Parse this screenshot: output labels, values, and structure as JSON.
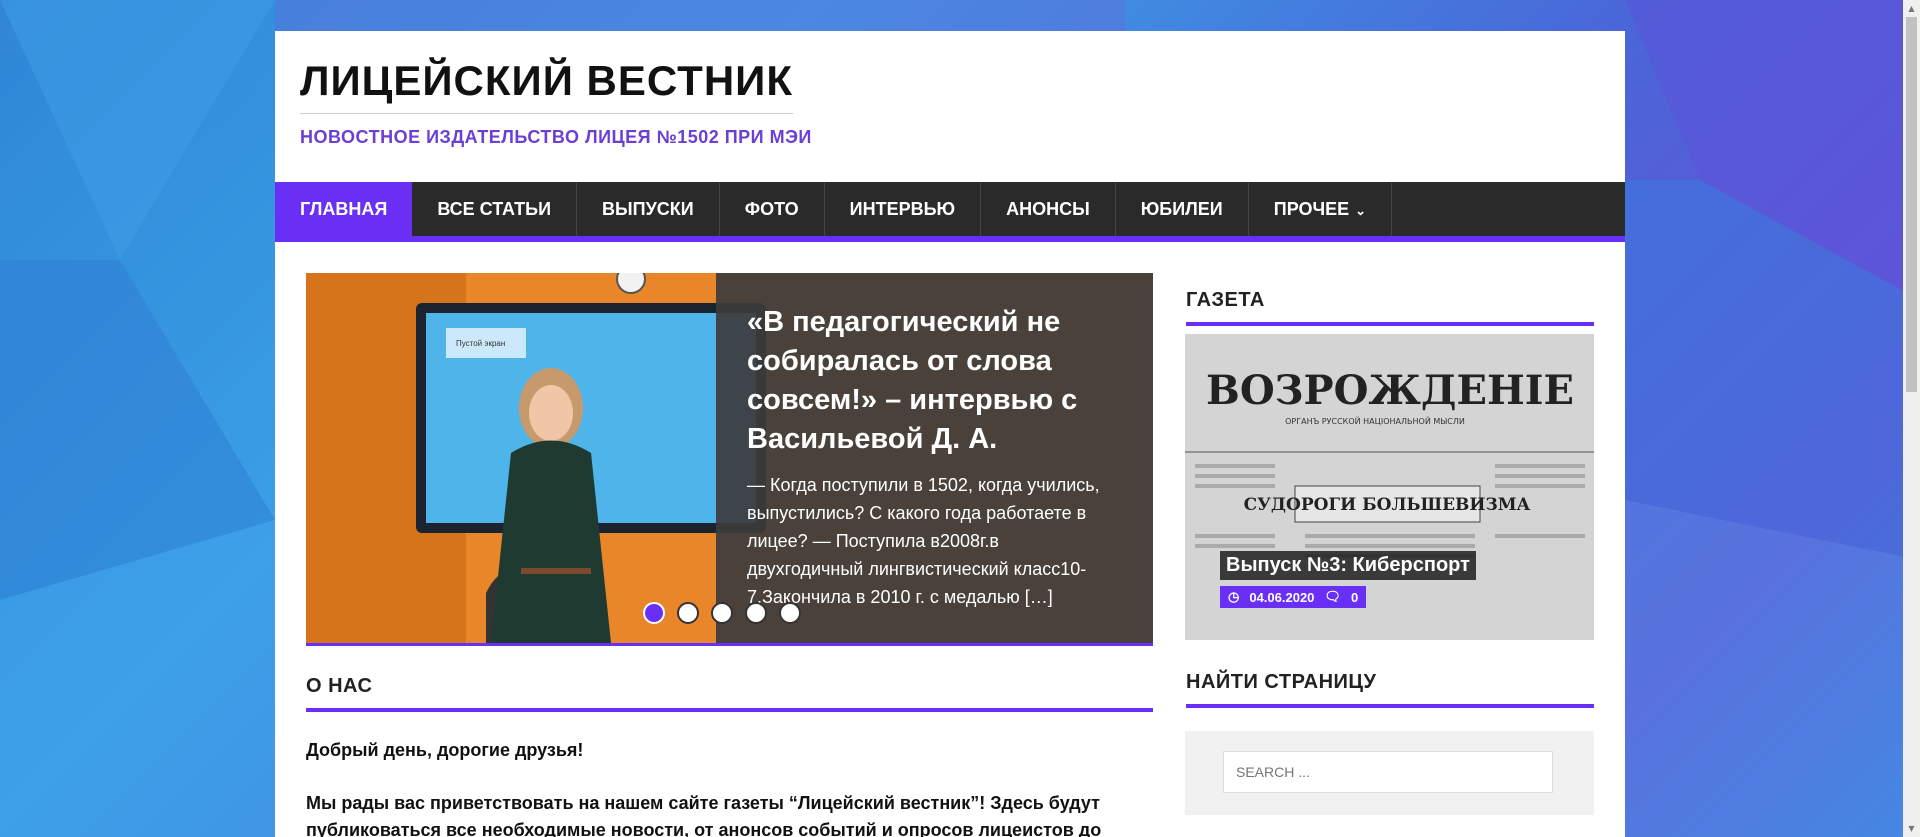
{
  "header": {
    "title": "ЛИЦЕЙСКИЙ ВЕСТНИК",
    "tagline": "НОВОСТНОЕ ИЗДАТЕЛЬСТВО ЛИЦЕЯ №1502 ПРИ МЭИ"
  },
  "nav": {
    "items": [
      {
        "label": "ГЛАВНАЯ"
      },
      {
        "label": "ВСЕ СТАТЬИ"
      },
      {
        "label": "ВЫПУСКИ"
      },
      {
        "label": "ФОТО"
      },
      {
        "label": "ИНТЕРВЬЮ"
      },
      {
        "label": "АНОНСЫ"
      },
      {
        "label": "ЮБИЛЕИ"
      },
      {
        "label": "ПРОЧЕЕ"
      }
    ]
  },
  "slider": {
    "title": "«В педагогический не собиралась от слова совсем!» – интервью с Васильевой Д. А.",
    "excerpt": "— Когда поступили в 1502, когда учились, выпустились? С какого года работаете в лицее? — Поступила в2008г.в двухгодичный лингвистический класс10-7.Закончила в 2010 г. с медалью […]",
    "screen_label": "Пустой экран"
  },
  "about": {
    "heading": "О НАС",
    "greeting": "Добрый день, дорогие друзья!",
    "text": "Мы рады вас приветствовать на нашем сайте газеты “Лицейский вестник”! Здесь будут публиковаться все необходимые новости, от анонсов событий и опросов лицеистов до"
  },
  "sidebar": {
    "gazeta_heading": "ГАЗЕТА",
    "newspaper_masthead": "ВОЗРОЖДЕНІЕ",
    "newspaper_sub": "ОРГАНЪ РУССКОЙ НАЦІОНАЛЬНОЙ МЫСЛИ",
    "newspaper_headline": "СУДОРОГИ БОЛЬШЕВИЗМА",
    "issue_title": "Выпуск №3: Киберспорт",
    "issue_date": "04.06.2020",
    "issue_comments": "0",
    "find_heading": "НАЙТИ СТРАНИЦУ",
    "search_placeholder": "SEARCH ..."
  },
  "colors": {
    "accent": "#6a2ff5",
    "nav_bg": "#2a2a2a",
    "tagline": "#6b3fd4"
  }
}
